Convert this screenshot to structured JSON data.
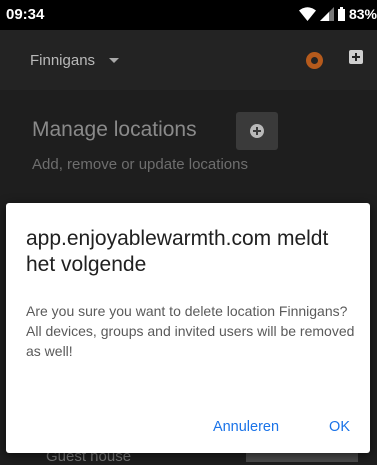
{
  "status_bar": {
    "time": "09:34",
    "battery": "83%"
  },
  "header": {
    "location": "Finnigans",
    "icons": [
      "chevron-down-icon",
      "logo-icon",
      "plus-icon"
    ]
  },
  "page": {
    "title": "Manage locations",
    "subtitle": "Add, remove or update locations",
    "partial_item": "Guest house"
  },
  "dialog": {
    "title": "app.enjoyablewarmth.com meldt het volgende",
    "message": "Are you sure you want to delete location Finnigans?\nAll devices, groups and invited users will be removed as well!",
    "cancel_label": "Annuleren",
    "ok_label": "OK"
  },
  "colors": {
    "accent": "#1a73e8",
    "background": "#1e1e1e",
    "dialog": "#ffffff"
  }
}
